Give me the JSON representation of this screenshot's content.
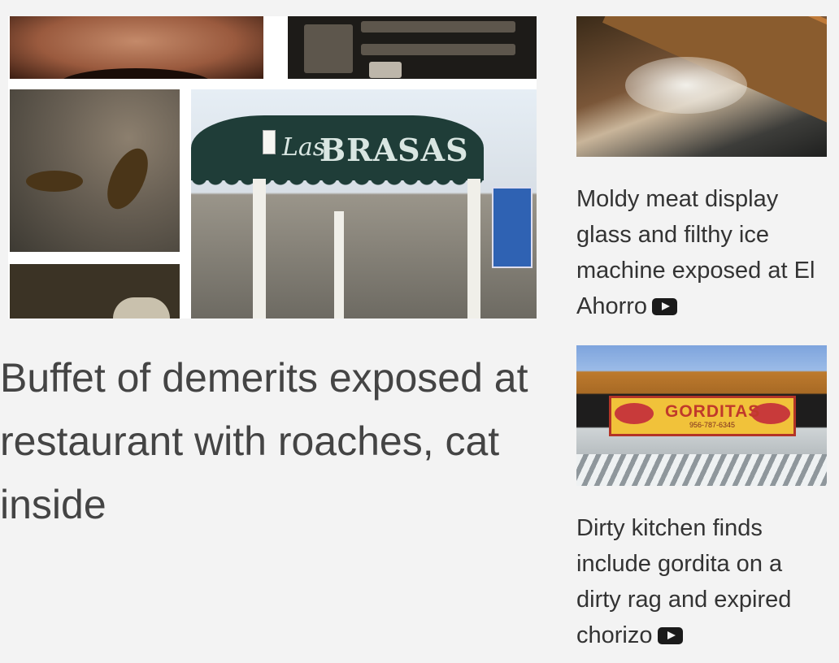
{
  "feature": {
    "headline": "Buffet of demerits exposed at restaurant with roaches, cat inside",
    "collage_sign_text": "BRASAS",
    "collage_sign_script": "Las"
  },
  "sidebar": [
    {
      "caption": "Moldy meat display glass and filthy ice machine exposed at El Ahorro",
      "icon": "video-play-icon"
    },
    {
      "caption": "Dirty kitchen finds include gordita on a dirty rag and expired chorizo",
      "icon": "video-play-icon",
      "thumb_sign_text": "GORDITAS",
      "thumb_sign_phone": "956-787-6345"
    }
  ],
  "colors": {
    "background": "#f3f3f3",
    "headline_text": "#444444",
    "caption_text": "#333333",
    "icon": "#1a1a1a"
  }
}
